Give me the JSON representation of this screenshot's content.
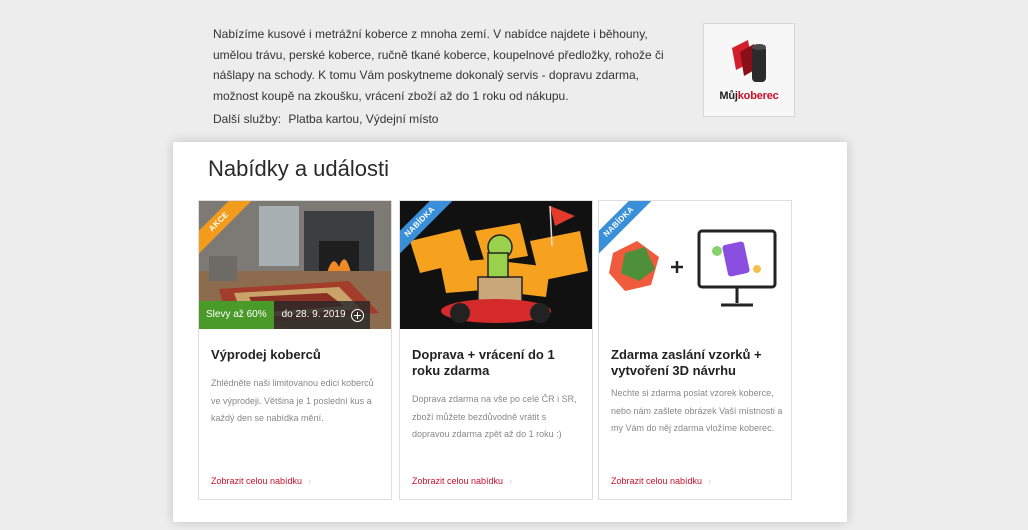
{
  "intro": {
    "lines": [
      "Nabízíme kusové i metrážní koberce z mnoha zemí. V nabídce najdete i běhouny,",
      "umělou trávu, perské koberce, ručně tkané koberce, koupelnové předložky, rohože či",
      "nášlapy na schody. K tomu Vám poskytneme dokonalý servis - dopravu zdarma,",
      "možnost koupě na zkoušku, vrácení zboží až do 1 roku od nákupu."
    ],
    "services_label": "Další služby:",
    "services_value": "Platba kartou, Výdejní místo"
  },
  "logo": {
    "text_part1": "Můj",
    "text_part2": "koberec"
  },
  "offers": {
    "title": "Nabídky a události",
    "cards": [
      {
        "ribbon": "AKCE",
        "discount": "Slevy až 60%",
        "date": "do 28. 9. 2019",
        "title": "Výprodej koberců",
        "desc": "Zhlédněte naši limitovanou edici koberců ve výprodeji. Většina je 1 poslední kus a každý den se nabídka mění.",
        "link": "Zobrazit celou nabídku"
      },
      {
        "ribbon": "NABÍDKA",
        "title": "Doprava + vrácení do 1 roku zdarma",
        "desc": "Doprava zdarma na vše po celé ČR i SR, zboží můžete bezdůvodně vrátit s dopravou zdarma zpět až do 1 roku :)",
        "link": "Zobrazit celou nabídku"
      },
      {
        "ribbon": "NABÍDKA",
        "title": "Zdarma zaslání vzorků + vytvoření 3D návrhu",
        "desc": "Nechte si zdarma poslat vzorek koberce, nebo nám zašlete obrázek Vaší místnosti a my Vám do něj zdarma vložíme koberec.",
        "link": "Zobrazit celou nabídku"
      }
    ]
  },
  "colors": {
    "accent": "#c8102e",
    "discount_green": "#4a9a2a",
    "ribbon_orange": "#f39b1b",
    "ribbon_blue": "#3a8fd9"
  }
}
